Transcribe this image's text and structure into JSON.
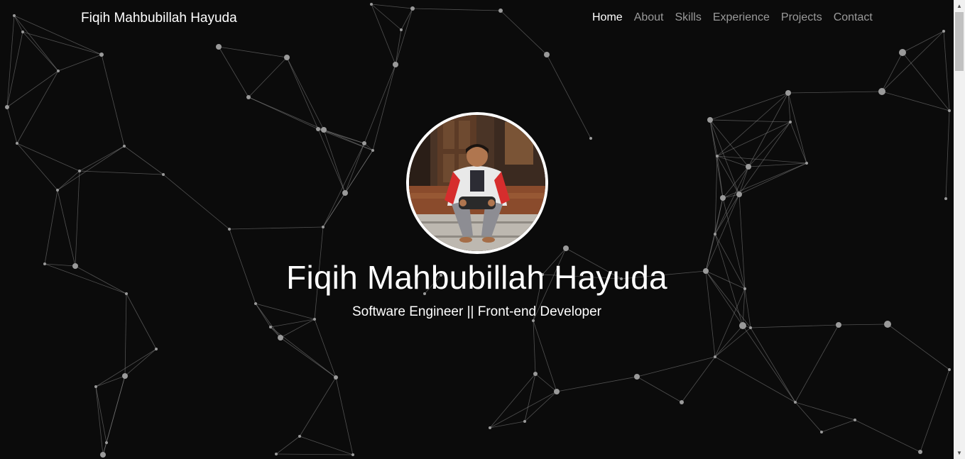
{
  "brand": {
    "name": "Fiqih Mahbubillah Hayuda"
  },
  "nav": {
    "items": [
      {
        "label": "Home",
        "active": true
      },
      {
        "label": "About",
        "active": false
      },
      {
        "label": "Skills",
        "active": false
      },
      {
        "label": "Experience",
        "active": false
      },
      {
        "label": "Projects",
        "active": false
      },
      {
        "label": "Contact",
        "active": false
      }
    ]
  },
  "hero": {
    "name": "Fiqih Mahbubillah Hayuda",
    "role": "Software Engineer || Front-end Developer",
    "avatar": "profile-photo"
  },
  "theme": {
    "background": "#0b0b0b",
    "text": "#ffffff",
    "nav_inactive": "#9a9a9a",
    "particle": "#9a9a9a"
  },
  "icons": {
    "scroll_up": "scroll-up-arrow-icon",
    "scroll_down": "scroll-down-arrow-icon"
  }
}
